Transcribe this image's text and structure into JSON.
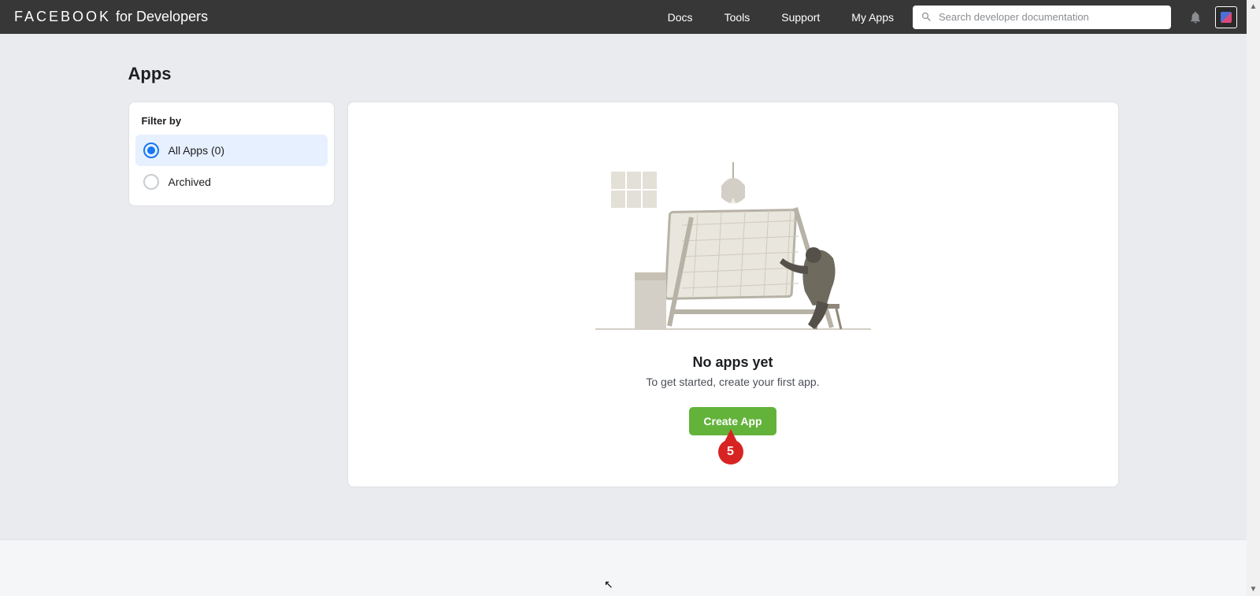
{
  "brand": {
    "main": "FACEBOOK",
    "suffix": "for Developers"
  },
  "nav": {
    "docs": "Docs",
    "tools": "Tools",
    "support": "Support",
    "myapps": "My Apps"
  },
  "search": {
    "placeholder": "Search developer documentation"
  },
  "page": {
    "title": "Apps"
  },
  "filter": {
    "title": "Filter by",
    "all": "All Apps (0)",
    "archived": "Archived"
  },
  "empty": {
    "title": "No apps yet",
    "subtitle": "To get started, create your first app.",
    "cta": "Create App"
  },
  "annotation": {
    "label": "5"
  }
}
